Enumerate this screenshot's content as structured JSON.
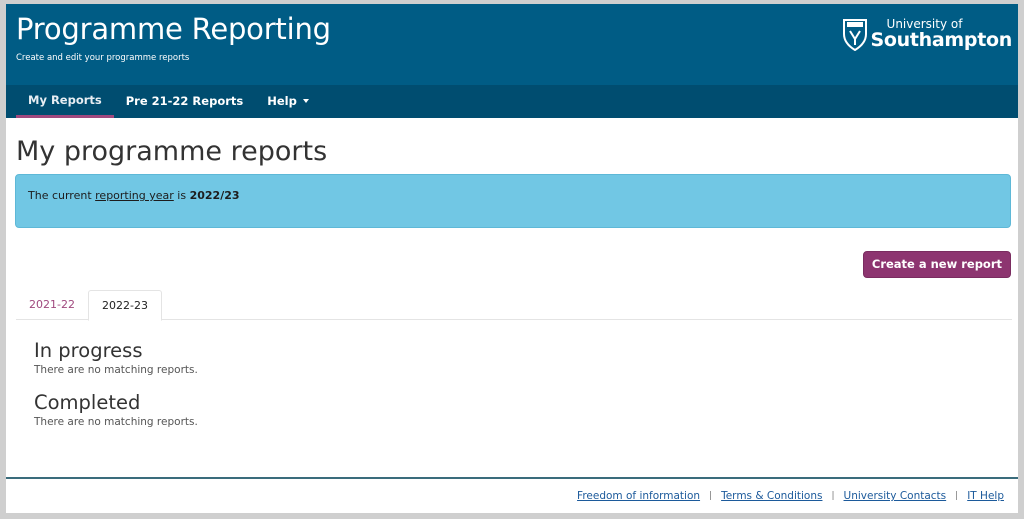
{
  "header": {
    "title": "Programme Reporting",
    "subtitle": "Create and edit your programme reports",
    "logo": {
      "icon": "university-crest-icon",
      "line1": "University of",
      "line2": "Southampton"
    }
  },
  "nav": {
    "items": [
      {
        "label": "My Reports",
        "active": true
      },
      {
        "label": "Pre 21-22 Reports",
        "active": false
      },
      {
        "label": "Help",
        "dropdown": true
      }
    ]
  },
  "main": {
    "title": "My programme reports",
    "alert": {
      "prefix": "The current ",
      "link": "reporting year",
      "middle": " is ",
      "year": "2022/23"
    },
    "create_button": "Create a new report",
    "tabs": [
      {
        "label": "2021-22",
        "active": false
      },
      {
        "label": "2022-23",
        "active": true
      }
    ],
    "sections": [
      {
        "title": "In progress",
        "empty": "There are no matching reports."
      },
      {
        "title": "Completed",
        "empty": "There are no matching reports."
      }
    ]
  },
  "footer": {
    "links": [
      "Freedom of information",
      "Terms & Conditions",
      "University Contacts",
      "IT Help"
    ],
    "separator": "|"
  },
  "colors": {
    "masthead": "#005c85",
    "navbar": "#004d70",
    "accent": "#8d3570",
    "alert": "#71c7e4"
  }
}
